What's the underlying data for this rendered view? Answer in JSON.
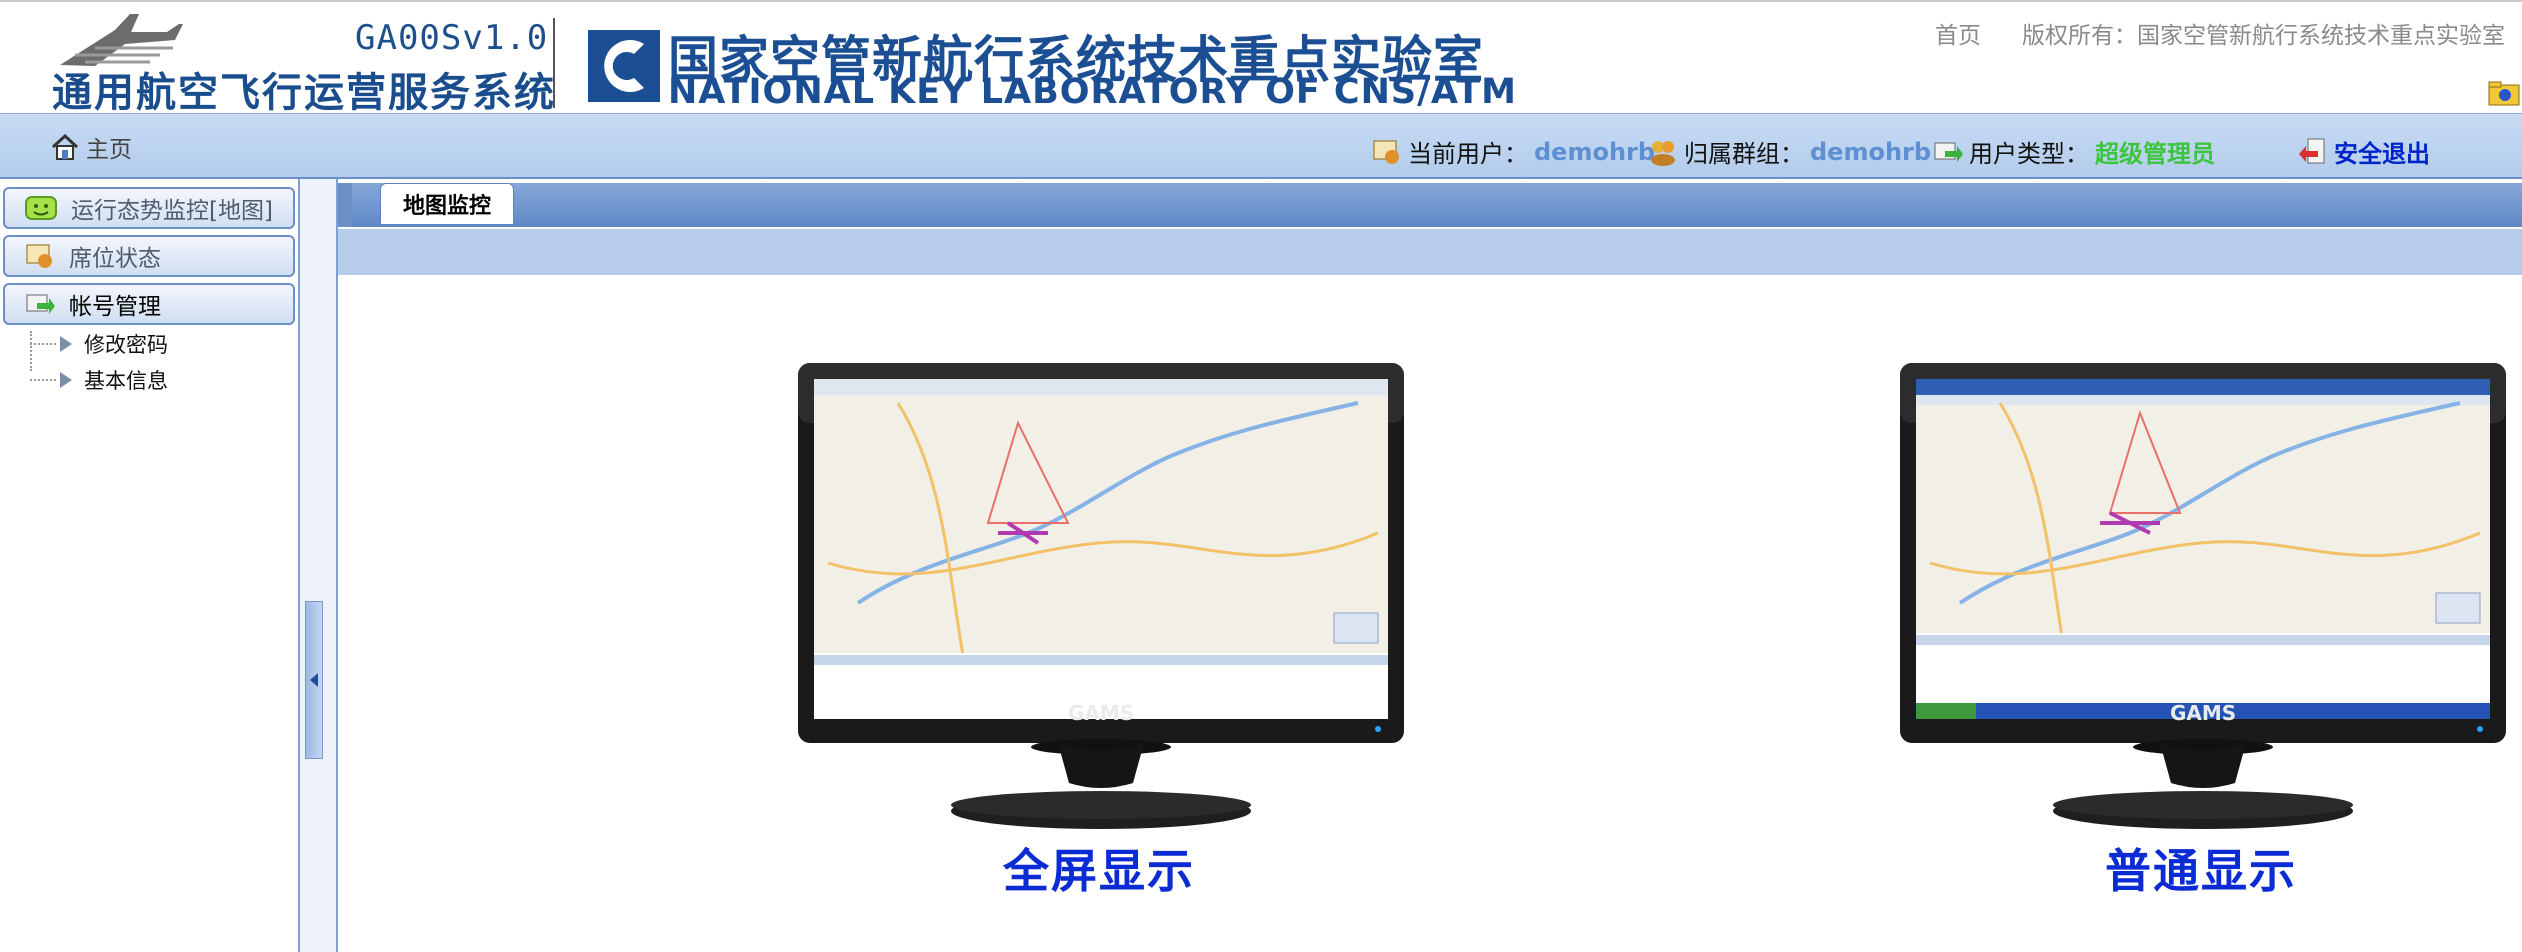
{
  "header": {
    "app_version": "GA00Sv1.0",
    "app_name": "通用航空飞行运营服务系统",
    "lab_name_cn": "国家空管新航行系统技术重点实验室",
    "lab_name_en": "NATIONAL KEY LABORATORY OF CNS/ATM",
    "home_link": "首页",
    "copyright": "版权所有：国家空管新航行系统技术重点实验室"
  },
  "navbar": {
    "home_label": "主页",
    "current_user_label": "当前用户：",
    "current_user_value": "demohrb",
    "group_label": "归属群组：",
    "group_value": "demohrb",
    "user_type_label": "用户类型：",
    "user_type_value": "超级管理员",
    "logout_label": "安全退出"
  },
  "sidebar": {
    "sections": [
      {
        "label": "运行态势监控[地图]"
      },
      {
        "label": "席位状态"
      },
      {
        "label": "帐号管理"
      }
    ],
    "account_items": [
      {
        "label": "修改密码"
      },
      {
        "label": "基本信息"
      }
    ]
  },
  "main": {
    "tabs": [
      {
        "label": "地图监控"
      }
    ],
    "monitors": [
      {
        "brand": "GAMS",
        "button_label": "全屏显示"
      },
      {
        "brand": "GAMS",
        "button_label": "普通显示"
      }
    ]
  },
  "colors": {
    "brand_blue": "#1b4e93",
    "nav_value": "#5e8fd3",
    "user_type": "#3cc43c",
    "logout": "#0024c9",
    "display_button": "#0b2bd4"
  }
}
